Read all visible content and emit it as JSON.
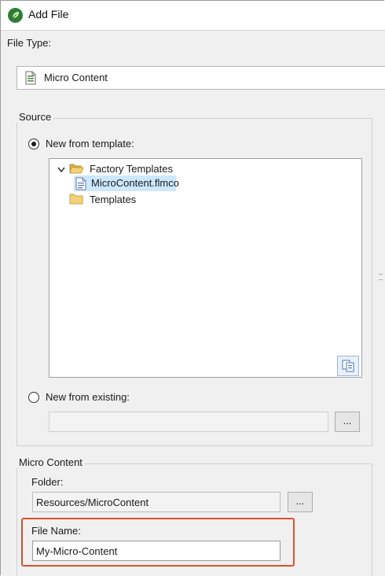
{
  "window": {
    "title": "Add File",
    "app_icon": "flare-leaf-icon"
  },
  "file_type": {
    "label": "File Type:",
    "value": "Micro Content",
    "icon": "document-icon"
  },
  "source": {
    "legend": "Source",
    "new_from_template": {
      "label": "New from template:",
      "checked": true
    },
    "tree": {
      "factory_templates": {
        "label": "Factory Templates",
        "expanded": true,
        "icon": "open-folder-icon"
      },
      "selected_file": {
        "label": "MicroContent.flmco",
        "icon": "template-file-icon"
      },
      "templates": {
        "label": "Templates",
        "icon": "folder-icon"
      }
    },
    "new_from_existing": {
      "label": "New from existing:",
      "checked": false,
      "value": ""
    },
    "browse_button_label": "..."
  },
  "micro_content": {
    "legend": "Micro Content",
    "folder": {
      "label": "Folder:",
      "value": "Resources/MicroContent",
      "browse_label": "..."
    },
    "file_name": {
      "label": "File Name:",
      "value": "My-Micro-Content"
    }
  },
  "colors": {
    "highlight_box": "#d9532c",
    "selection": "#cce8ff",
    "folder": "#e8c35a"
  }
}
